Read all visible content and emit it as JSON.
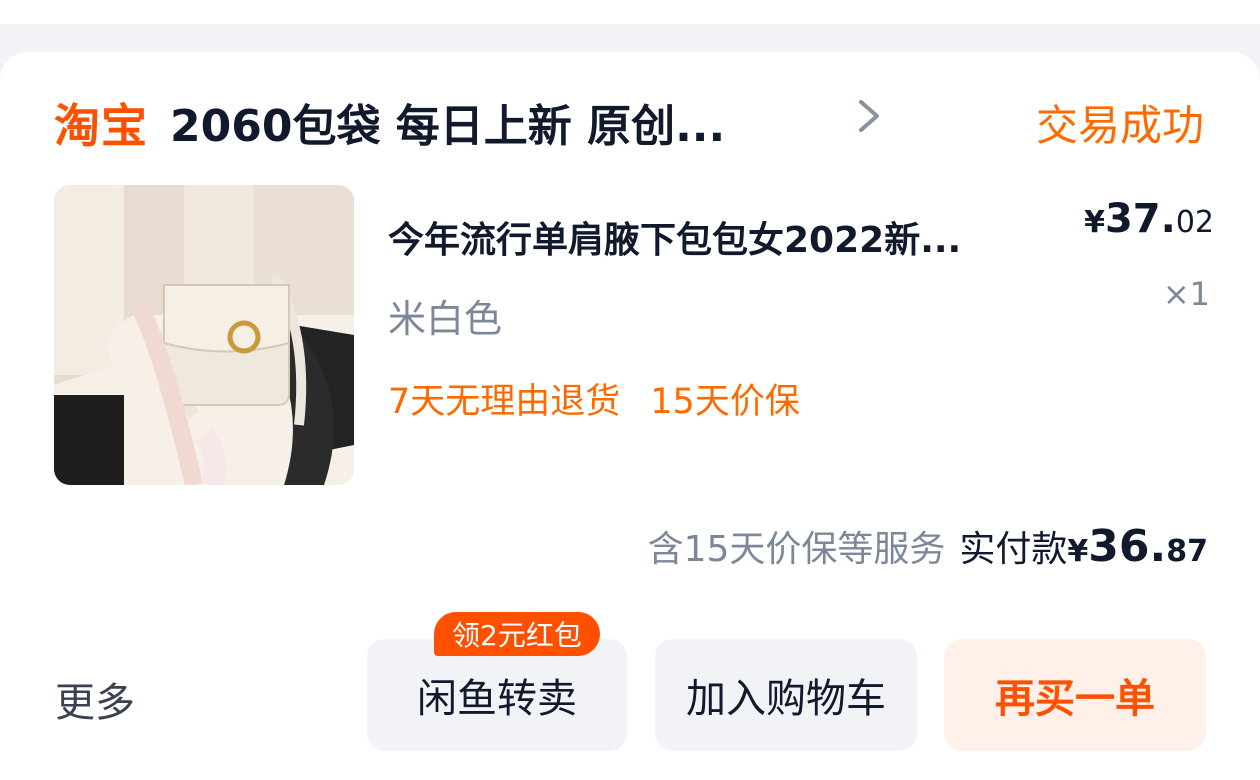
{
  "shop": {
    "logo_text": "淘宝",
    "name": "2060包袋 每日上新 原创...",
    "chevron_icon": "chevron-right-icon"
  },
  "order": {
    "status": "交易成功"
  },
  "product": {
    "title": "今年流行单肩腋下包包女2022新...",
    "sku": "米白色",
    "tags": [
      "7天无理由退货",
      "15天价保"
    ],
    "price": {
      "symbol": "¥",
      "int": "37.",
      "dec": "02"
    },
    "quantity": "×1",
    "image": "cream-shoulder-bag-photo"
  },
  "summary": {
    "services": "含15天价保等服务",
    "paid_label": "实付款",
    "symbol": "¥",
    "int": "36.",
    "dec": "87"
  },
  "actions": {
    "more": "更多",
    "resell": "闲鱼转卖",
    "promo_badge": "领2元红包",
    "add_to_cart": "加入购物车",
    "rebuy": "再买一单"
  },
  "colors": {
    "accent": "#ff5000",
    "status": "#ff6a00",
    "text_primary": "#11192d",
    "text_secondary": "#7c8799",
    "button_bg": "#f1f3f7",
    "rebuy_bg": "#fff1e9"
  }
}
